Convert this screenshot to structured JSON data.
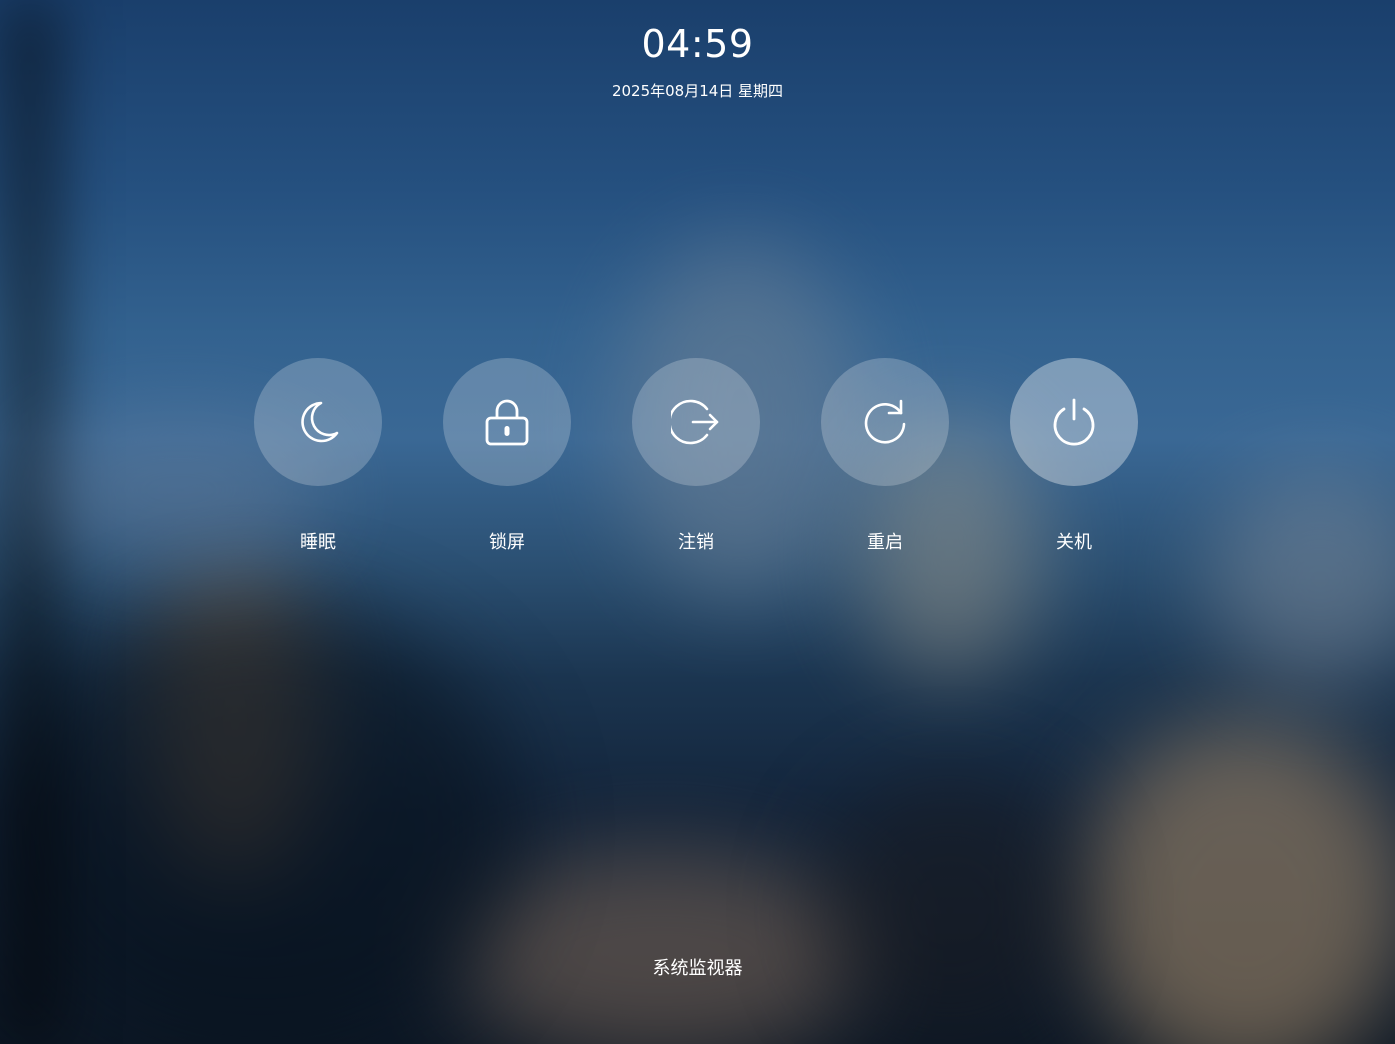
{
  "clock": {
    "time": "04:59",
    "date": "2025年08月14日 星期四"
  },
  "actions": [
    {
      "label": "睡眠",
      "icon": "moon-icon"
    },
    {
      "label": "锁屏",
      "icon": "lock-icon"
    },
    {
      "label": "注销",
      "icon": "logout-icon"
    },
    {
      "label": "重启",
      "icon": "restart-icon"
    },
    {
      "label": "关机",
      "icon": "power-icon",
      "selected": true
    }
  ],
  "footer": {
    "system_monitor_label": "系统监视器"
  }
}
